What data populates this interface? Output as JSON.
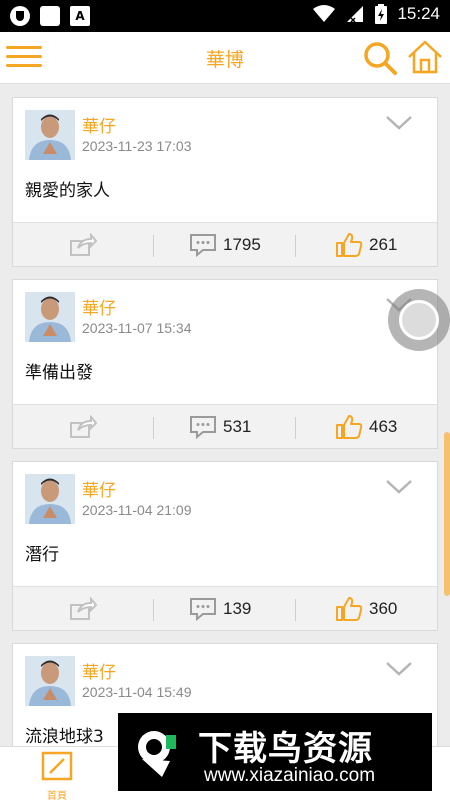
{
  "status_bar": {
    "time": "15:24",
    "app_letter": "A"
  },
  "header": {
    "title": "華博"
  },
  "posts": [
    {
      "author": "華仔",
      "time": "2023-11-23 17:03",
      "content": "親愛的家人",
      "comments": "1795",
      "likes": "261"
    },
    {
      "author": "華仔",
      "time": "2023-11-07 15:34",
      "content": "準備出發",
      "comments": "531",
      "likes": "463"
    },
    {
      "author": "華仔",
      "time": "2023-11-04 21:09",
      "content": "潛行",
      "comments": "139",
      "likes": "360"
    },
    {
      "author": "華仔",
      "time": "2023-11-04 15:49",
      "content": "流浪地球3"
    }
  ],
  "tabbar": {
    "home_label": "首頁"
  },
  "watermark": {
    "title": "下载鸟资源",
    "url": "www.xiazainiao.com"
  },
  "colors": {
    "accent": "#f5a623",
    "background": "#ececec",
    "card": "#ffffff"
  },
  "icons": [
    "menu-icon",
    "search-icon",
    "home-icon",
    "chevron-down-icon",
    "share-icon",
    "comment-icon",
    "like-icon",
    "edit-icon"
  ]
}
